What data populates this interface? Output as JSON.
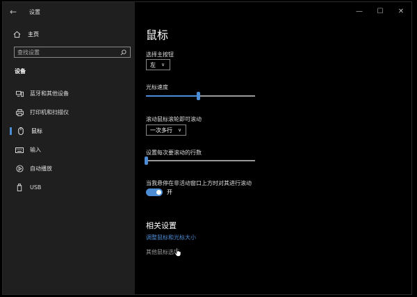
{
  "window": {
    "title": "设置"
  },
  "sidebar": {
    "home_label": "主页",
    "search_placeholder": "查找设置",
    "section_label": "设备",
    "items": [
      {
        "label": "蓝牙和其他设备",
        "icon": "bluetooth-devices-icon"
      },
      {
        "label": "打印机和扫描仪",
        "icon": "printer-icon"
      },
      {
        "label": "鼠标",
        "icon": "mouse-icon",
        "active": true
      },
      {
        "label": "输入",
        "icon": "keyboard-icon"
      },
      {
        "label": "自动播放",
        "icon": "autoplay-icon"
      },
      {
        "label": "USB",
        "icon": "usb-icon"
      }
    ]
  },
  "main": {
    "title": "鼠标",
    "primary_button": {
      "label": "选择主按钮",
      "value": "左"
    },
    "cursor_speed": {
      "label": "光标速度",
      "value_fraction": 0.48
    },
    "scroll": {
      "label": "滚动鼠标滚轮即可滚动",
      "value": "一次多行"
    },
    "lines": {
      "label": "设置每次要滚动的行数",
      "value_fraction": 0.0
    },
    "inactive_scroll": {
      "label": "当我悬停在非活动窗口上方时对其进行滚动",
      "state": "开"
    },
    "related": {
      "title": "相关设置",
      "link1": "调整鼠标和光标大小",
      "link2": "其他鼠标选项"
    }
  },
  "colors": {
    "accent": "#4c8dd6",
    "sidebar_bg": "#1f1f1f",
    "main_bg": "#000000"
  }
}
